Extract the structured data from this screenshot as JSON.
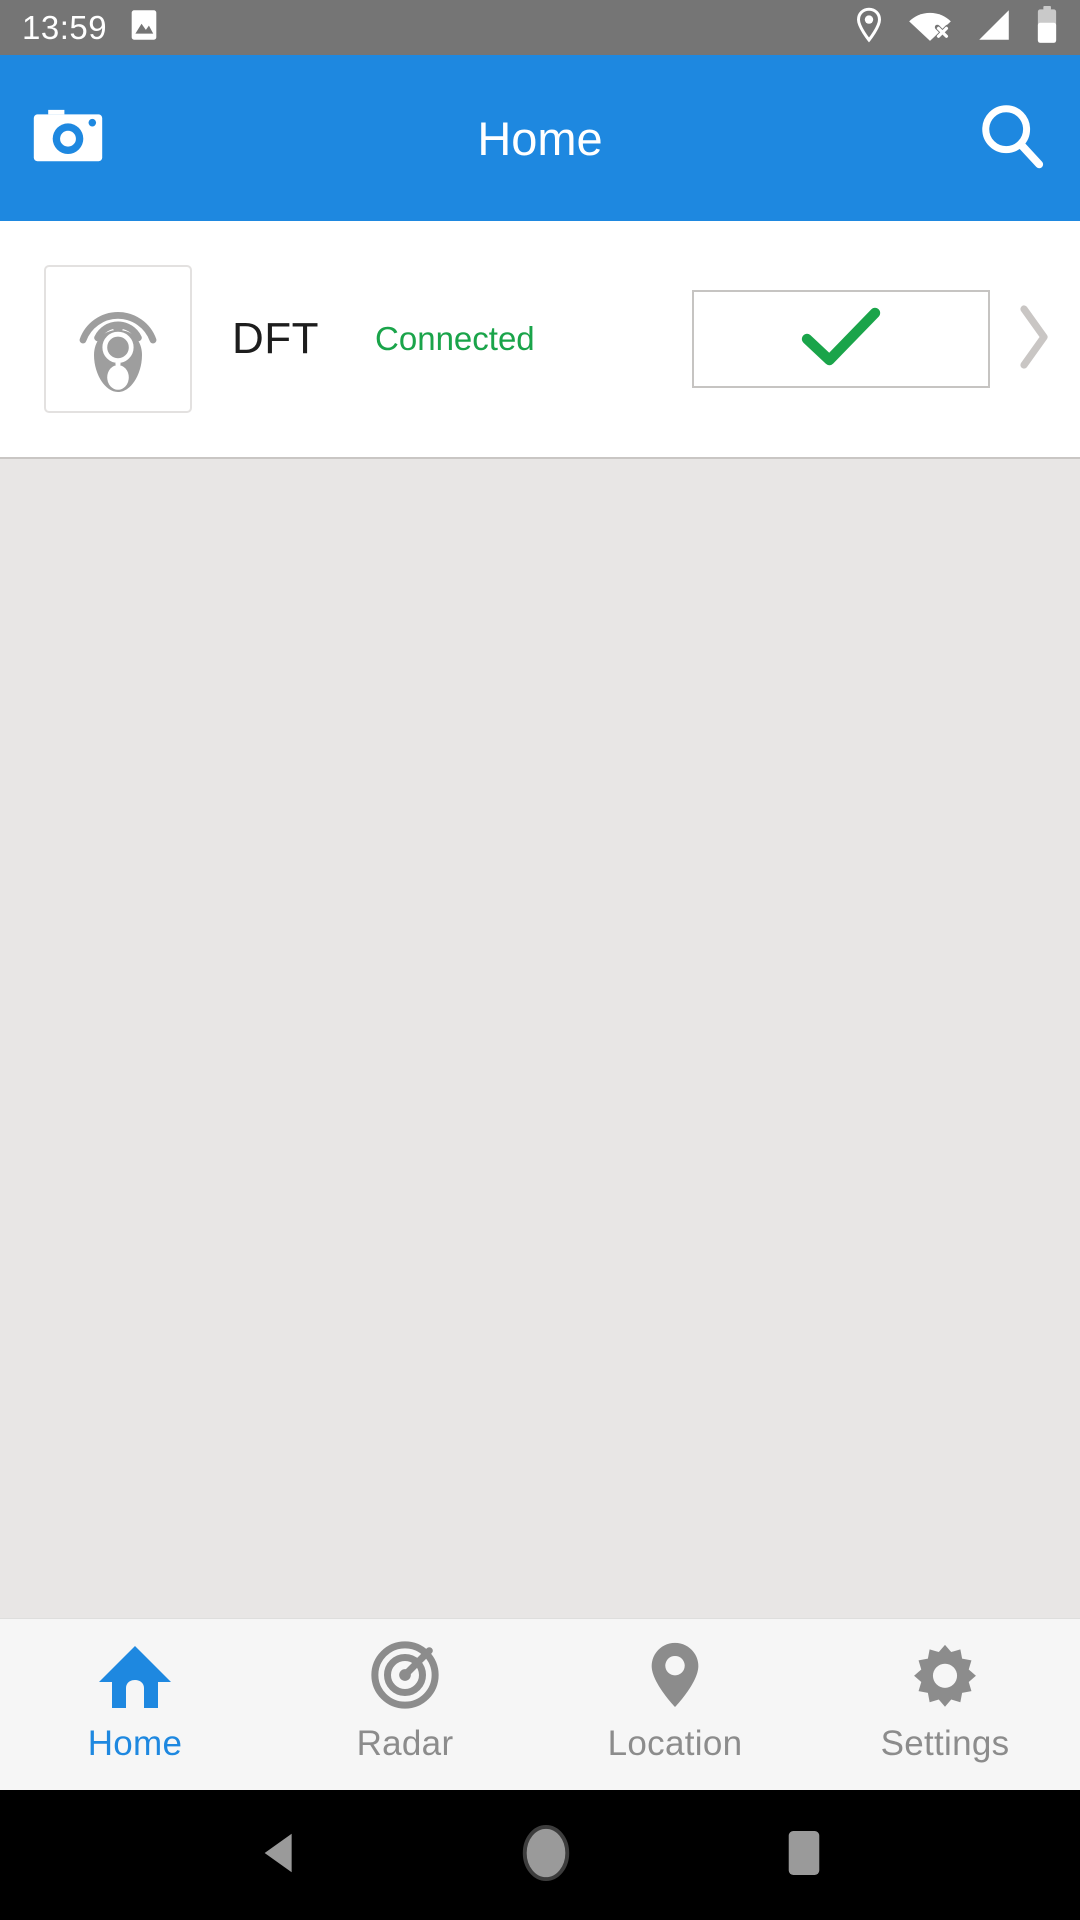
{
  "statusbar": {
    "time": "13:59",
    "left_icons": [
      {
        "name": "image-icon",
        "glyph": "image"
      }
    ],
    "right_icons": [
      {
        "name": "location-pin-icon",
        "glyph": "location"
      },
      {
        "name": "wifi-off-icon",
        "glyph": "wifi-x"
      },
      {
        "name": "cellular-signal-icon",
        "glyph": "signal"
      },
      {
        "name": "battery-icon",
        "glyph": "battery",
        "level": 60
      }
    ],
    "background_color": "#757575",
    "text_color": "#ffffff"
  },
  "appbar": {
    "title": "Home",
    "background_color": "#1e88e0",
    "left_button": {
      "name": "camera-button",
      "icon": "camera-icon"
    },
    "right_button": {
      "name": "search-button",
      "icon": "search-icon"
    }
  },
  "device_list": {
    "devices": [
      {
        "name": "DFT",
        "status": "Connected",
        "status_color": "#1aa44a",
        "icon": "tag-beacon-icon",
        "action_icon": "check-icon",
        "action_color": "#1aa44a",
        "chevron": "chevron-right-icon"
      }
    ]
  },
  "content": {
    "background_color": "#e8e6e5"
  },
  "bottom_nav": {
    "active_color": "#1e88e0",
    "inactive_color": "#8c8c8c",
    "items": [
      {
        "label": "Home",
        "icon": "home-icon",
        "active": true
      },
      {
        "label": "Radar",
        "icon": "radar-icon",
        "active": false
      },
      {
        "label": "Location",
        "icon": "location-icon",
        "active": false
      },
      {
        "label": "Settings",
        "icon": "settings-icon",
        "active": false
      }
    ]
  },
  "android_nav": {
    "background_color": "#000000",
    "buttons": [
      {
        "name": "back-button",
        "icon": "back-triangle-icon"
      },
      {
        "name": "home-button",
        "icon": "home-circle-icon"
      },
      {
        "name": "recents-button",
        "icon": "recents-square-icon"
      }
    ]
  }
}
